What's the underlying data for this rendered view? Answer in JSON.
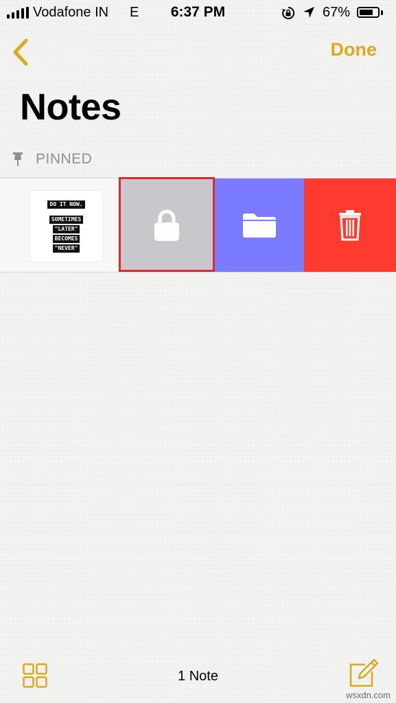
{
  "status_bar": {
    "carrier": "Vodafone IN",
    "network": "E",
    "time": "6:37 PM",
    "battery": "67%",
    "battery_level": 0.67,
    "icons": [
      "signal-icon",
      "rotation-lock-icon",
      "location-icon",
      "battery-icon"
    ]
  },
  "nav": {
    "back_icon": "chevron-left-icon",
    "done_label": "Done",
    "accent": "#dca81d"
  },
  "page": {
    "title": "Notes"
  },
  "section": {
    "pin_icon": "pin-icon",
    "label": "PINNED"
  },
  "note": {
    "thumbnail_lines": [
      "DO IT NOW.",
      "SOMETIMES",
      "\"LATER\"",
      "BECOMES",
      "\"NEVER\""
    ]
  },
  "swipe_actions": [
    {
      "icon": "lock-icon",
      "color": "#c7c7cc"
    },
    {
      "icon": "folder-icon",
      "color": "#7b7bff"
    },
    {
      "icon": "trash-icon",
      "color": "#ff3b30"
    }
  ],
  "highlight_color": "#e0262c",
  "toolbar": {
    "grid_icon": "gallery-grid-icon",
    "count_label": "1 Note",
    "compose_icon": "compose-icon"
  },
  "watermark": "wsxdn.com"
}
